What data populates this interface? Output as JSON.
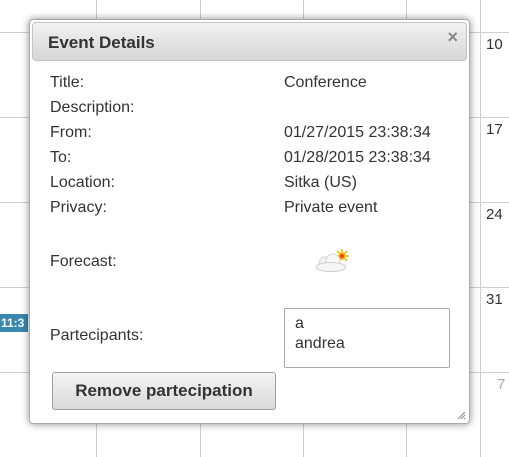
{
  "calendar": {
    "day_numbers": [
      "10",
      "17",
      "24",
      "31",
      "7"
    ],
    "event_chip_label": "11:3"
  },
  "dialog": {
    "title": "Event Details",
    "close_glyph": "×",
    "fields": {
      "title_label": "Title:",
      "title_value": "Conference",
      "description_label": "Description:",
      "description_value": "",
      "from_label": "From:",
      "from_value": "01/27/2015 23:38:34",
      "to_label": "To:",
      "to_value": "01/28/2015 23:38:34",
      "location_label": "Location:",
      "location_value": "Sitka (US)",
      "privacy_label": "Privacy:",
      "privacy_value": "Private event",
      "forecast_label": "Forecast:",
      "forecast_icon": "partly-cloudy-icon",
      "participants_label": "Partecipants:"
    },
    "participants": [
      "a",
      "andrea"
    ],
    "remove_button_label": "Remove partecipation"
  },
  "colors": {
    "event_chip": "#3a87ad",
    "text": "#333333",
    "grid": "#cfcfcf"
  }
}
